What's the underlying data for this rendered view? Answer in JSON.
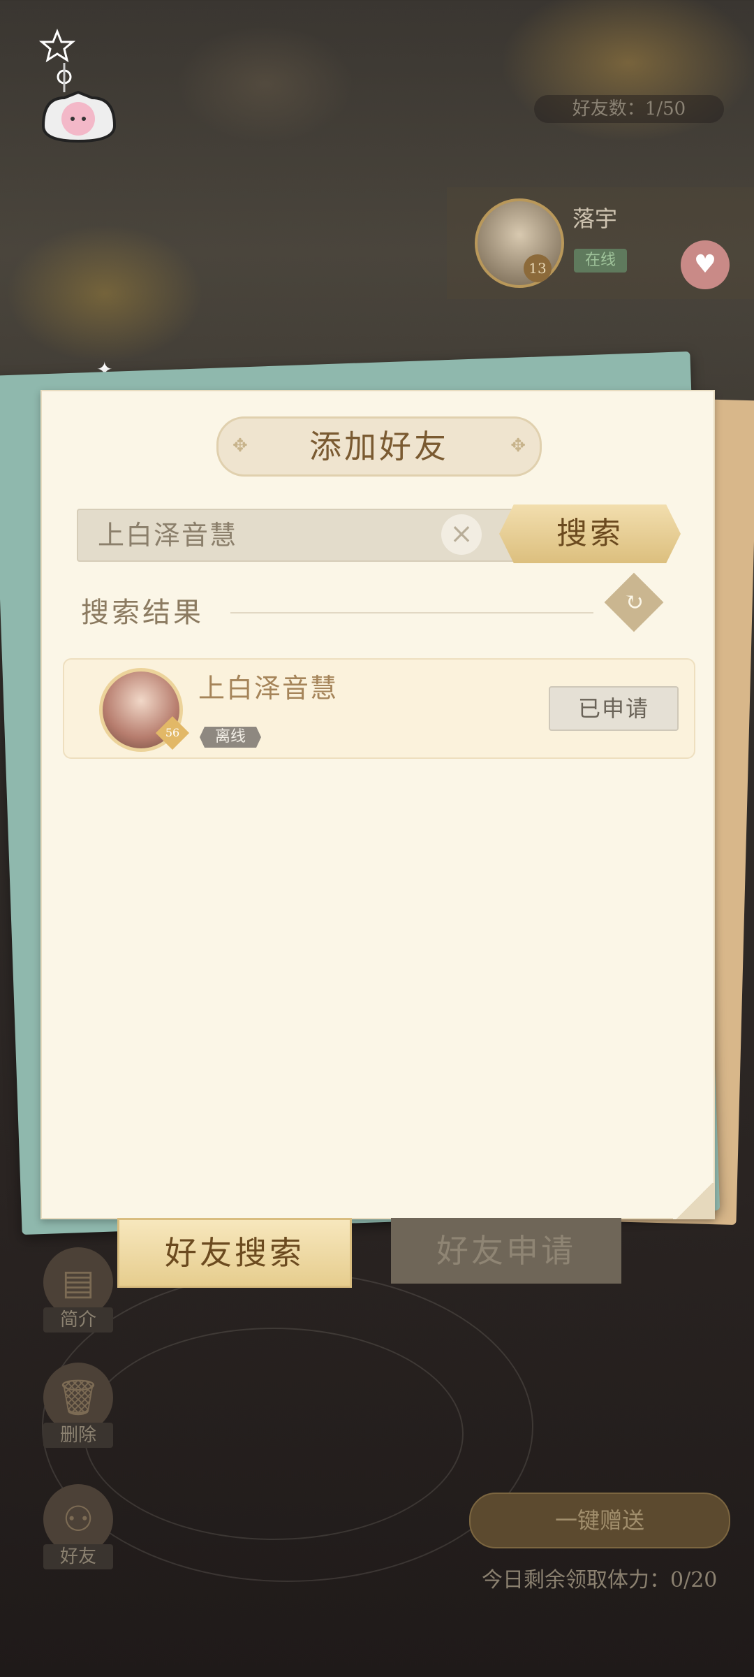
{
  "friend_count": "好友数：1/50",
  "friend_card": {
    "name": "落宇",
    "status": "在线",
    "level": "13"
  },
  "dialog": {
    "title": "添加好友",
    "search": {
      "value": "上白泽音慧",
      "button_label": "搜索"
    },
    "results_label": "搜索结果",
    "results": [
      {
        "name": "上白泽音慧",
        "status": "离线",
        "level": "56",
        "action_label": "已申请"
      }
    ]
  },
  "tabs": [
    {
      "label": "好友搜索",
      "active": true
    },
    {
      "label": "好友申请",
      "active": false
    }
  ],
  "side_actions": [
    {
      "label": "简介",
      "icon": "profile-card-icon"
    },
    {
      "label": "删除",
      "icon": "trash-icon"
    },
    {
      "label": "好友",
      "icon": "add-friend-icon"
    }
  ],
  "gift_button_label": "一键赠送",
  "stamina_text": "今日剩余领取体力：0/20",
  "colors": {
    "panel": "#fbf6e7",
    "accent_gold": "#dcbf7e",
    "teal": "#8fb8ad"
  }
}
